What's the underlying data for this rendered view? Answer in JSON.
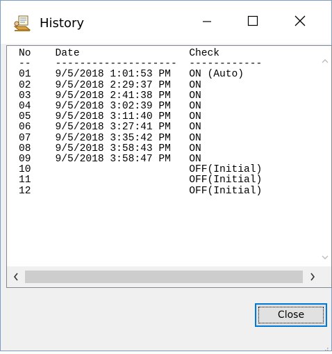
{
  "window": {
    "title": "History"
  },
  "titlebar": {
    "app_icon": "history-app-icon",
    "minimize_icon": "minimize-icon",
    "maximize_icon": "maximize-icon",
    "close_icon": "close-icon"
  },
  "history": {
    "text": "No    Date                  Check\n--    --------------------  ------------\n01    9/5/2018 1:01:53 PM   ON (Auto)\n02    9/5/2018 2:29:37 PM   ON\n03    9/5/2018 2:41:38 PM   ON\n04    9/5/2018 3:02:39 PM   ON\n05    9/5/2018 3:11:40 PM   ON\n06    9/5/2018 3:27:41 PM   ON\n07    9/5/2018 3:35:42 PM   ON\n08    9/5/2018 3:58:43 PM   ON\n09    9/5/2018 3:58:47 PM   ON\n10                          OFF(Initial)\n11                          OFF(Initial)\n12                          OFF(Initial)",
    "columns": [
      "No",
      "Date",
      "Check"
    ],
    "rows": [
      {
        "no": "01",
        "date": "9/5/2018 1:01:53 PM",
        "check": "ON (Auto)"
      },
      {
        "no": "02",
        "date": "9/5/2018 2:29:37 PM",
        "check": "ON"
      },
      {
        "no": "03",
        "date": "9/5/2018 2:41:38 PM",
        "check": "ON"
      },
      {
        "no": "04",
        "date": "9/5/2018 3:02:39 PM",
        "check": "ON"
      },
      {
        "no": "05",
        "date": "9/5/2018 3:11:40 PM",
        "check": "ON"
      },
      {
        "no": "06",
        "date": "9/5/2018 3:27:41 PM",
        "check": "ON"
      },
      {
        "no": "07",
        "date": "9/5/2018 3:35:42 PM",
        "check": "ON"
      },
      {
        "no": "08",
        "date": "9/5/2018 3:58:43 PM",
        "check": "ON"
      },
      {
        "no": "09",
        "date": "9/5/2018 3:58:47 PM",
        "check": "ON"
      },
      {
        "no": "10",
        "date": "",
        "check": "OFF(Initial)"
      },
      {
        "no": "11",
        "date": "",
        "check": "OFF(Initial)"
      },
      {
        "no": "12",
        "date": "",
        "check": "OFF(Initial)"
      }
    ]
  },
  "scrollbars": {
    "up_icon": "chevron-up-icon",
    "down_icon": "chevron-down-icon",
    "left_icon": "chevron-left-icon",
    "right_icon": "chevron-right-icon"
  },
  "footer": {
    "close_label": "Close"
  },
  "colors": {
    "focus_border": "#0078d7",
    "button_face": "#e1e1e1",
    "dialog_bg": "#f0f0f0"
  }
}
